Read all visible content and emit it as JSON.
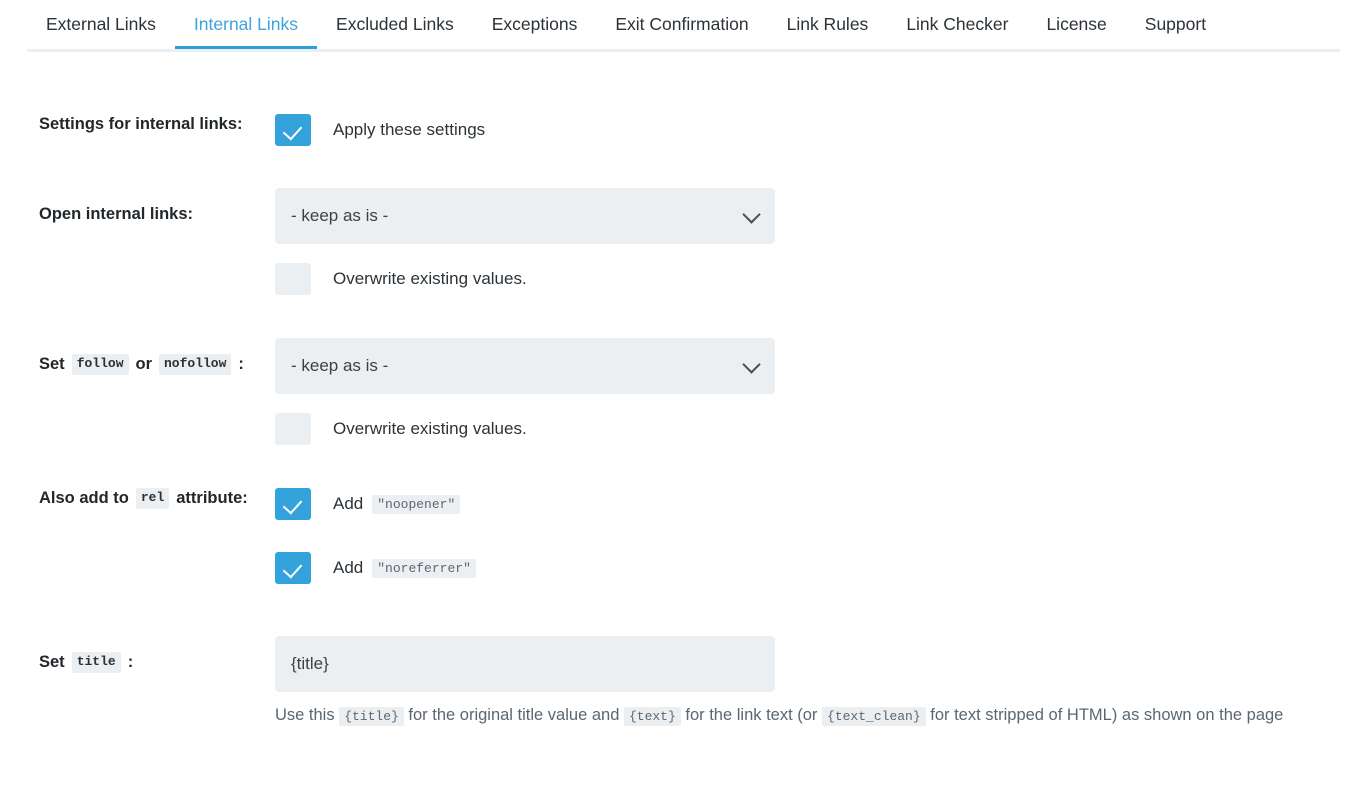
{
  "tabs": [
    {
      "label": "External Links",
      "active": false
    },
    {
      "label": "Internal Links",
      "active": true
    },
    {
      "label": "Excluded Links",
      "active": false
    },
    {
      "label": "Exceptions",
      "active": false
    },
    {
      "label": "Exit Confirmation",
      "active": false
    },
    {
      "label": "Link Rules",
      "active": false
    },
    {
      "label": "Link Checker",
      "active": false
    },
    {
      "label": "License",
      "active": false
    },
    {
      "label": "Support",
      "active": false
    }
  ],
  "rows": {
    "settings": {
      "label": "Settings for internal links:",
      "checkbox_label": "Apply these settings",
      "checked": true
    },
    "open_links": {
      "label": "Open internal links:",
      "select_value": "- keep as is -",
      "select_icon": "chevron-down-icon",
      "overwrite_label": "Overwrite existing values.",
      "overwrite_checked": false
    },
    "follow": {
      "label_set": "Set",
      "label_code_follow": "follow",
      "label_or": "or",
      "label_code_nofollow": "nofollow",
      "label_colon": ":",
      "select_value": "- keep as is -",
      "select_icon": "chevron-down-icon",
      "overwrite_label": "Overwrite existing values.",
      "overwrite_checked": false
    },
    "rel": {
      "label_prefix": "Also add to",
      "label_code": "rel",
      "label_suffix": "attribute:",
      "noopener": {
        "add_label": "Add",
        "value": "\"noopener\"",
        "checked": true
      },
      "noreferrer": {
        "add_label": "Add",
        "value": "\"noreferrer\"",
        "checked": true
      }
    },
    "title": {
      "label_set": "Set",
      "label_code": "title",
      "label_colon": ":",
      "input_value": "{title}",
      "help": {
        "p1": "Use this",
        "c1": "{title}",
        "p2": "for the original title value and",
        "c2": "{text}",
        "p3": "for the link text (or",
        "c3": "{text_clean}",
        "p4": "for text stripped of HTML) as shown on the page"
      }
    }
  },
  "colors": {
    "accent": "#34a3dc",
    "tab_active": "#3ea3dc",
    "field_bg": "#eceff1",
    "border": "#e9eff3"
  }
}
